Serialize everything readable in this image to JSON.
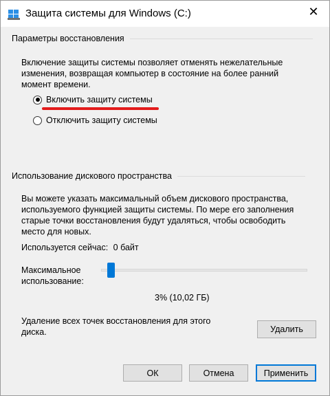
{
  "window": {
    "title": "Защита системы для Windows (C:)",
    "close_glyph": "✕"
  },
  "restore_settings": {
    "header": "Параметры восстановления",
    "description_lines": [
      "Включение защиты системы позволяет отменять нежелательные",
      "изменения, возвращая компьютер в состояние на более ранний",
      "момент времени."
    ],
    "options": [
      {
        "label": "Включить защиту системы",
        "checked": true
      },
      {
        "label": "Отключить защиту системы",
        "checked": false
      }
    ],
    "highlight_color": "#e31b1b"
  },
  "disk_usage": {
    "header": "Использование дискового пространства",
    "description_lines": [
      "Вы можете указать максимальный объем дискового пространства,",
      "используемого функцией защиты системы. По мере его заполнения",
      "старые точки восстановления будут удаляться, чтобы освободить",
      "место для новых."
    ],
    "current_usage_label": "Используется сейчас:",
    "current_usage_value": "0 байт",
    "max_usage_label_line1": "Максимальное",
    "max_usage_label_line2": "использование:",
    "max_usage_percent": 3,
    "max_usage_text": "3% (10,02 ГБ)",
    "slider_color": "#0078d7"
  },
  "delete_section": {
    "text_line1": "Удаление всех точек восстановления для этого",
    "text_line2": "диска.",
    "delete_button": "Удалить"
  },
  "footer": {
    "ok": "ОК",
    "cancel": "Отмена",
    "apply": "Применить"
  }
}
